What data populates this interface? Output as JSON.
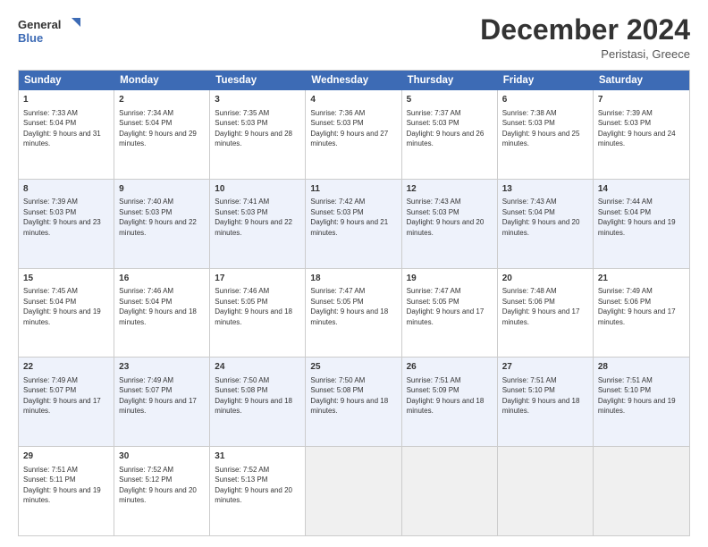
{
  "logo": {
    "line1": "General",
    "line2": "Blue"
  },
  "title": "December 2024",
  "location": "Peristasi, Greece",
  "days": [
    "Sunday",
    "Monday",
    "Tuesday",
    "Wednesday",
    "Thursday",
    "Friday",
    "Saturday"
  ],
  "weeks": [
    [
      {
        "date": "1",
        "sunrise": "7:33 AM",
        "sunset": "5:04 PM",
        "daylight": "9 hours and 31 minutes."
      },
      {
        "date": "2",
        "sunrise": "7:34 AM",
        "sunset": "5:04 PM",
        "daylight": "9 hours and 29 minutes."
      },
      {
        "date": "3",
        "sunrise": "7:35 AM",
        "sunset": "5:03 PM",
        "daylight": "9 hours and 28 minutes."
      },
      {
        "date": "4",
        "sunrise": "7:36 AM",
        "sunset": "5:03 PM",
        "daylight": "9 hours and 27 minutes."
      },
      {
        "date": "5",
        "sunrise": "7:37 AM",
        "sunset": "5:03 PM",
        "daylight": "9 hours and 26 minutes."
      },
      {
        "date": "6",
        "sunrise": "7:38 AM",
        "sunset": "5:03 PM",
        "daylight": "9 hours and 25 minutes."
      },
      {
        "date": "7",
        "sunrise": "7:39 AM",
        "sunset": "5:03 PM",
        "daylight": "9 hours and 24 minutes."
      }
    ],
    [
      {
        "date": "8",
        "sunrise": "7:39 AM",
        "sunset": "5:03 PM",
        "daylight": "9 hours and 23 minutes."
      },
      {
        "date": "9",
        "sunrise": "7:40 AM",
        "sunset": "5:03 PM",
        "daylight": "9 hours and 22 minutes."
      },
      {
        "date": "10",
        "sunrise": "7:41 AM",
        "sunset": "5:03 PM",
        "daylight": "9 hours and 22 minutes."
      },
      {
        "date": "11",
        "sunrise": "7:42 AM",
        "sunset": "5:03 PM",
        "daylight": "9 hours and 21 minutes."
      },
      {
        "date": "12",
        "sunrise": "7:43 AM",
        "sunset": "5:03 PM",
        "daylight": "9 hours and 20 minutes."
      },
      {
        "date": "13",
        "sunrise": "7:43 AM",
        "sunset": "5:04 PM",
        "daylight": "9 hours and 20 minutes."
      },
      {
        "date": "14",
        "sunrise": "7:44 AM",
        "sunset": "5:04 PM",
        "daylight": "9 hours and 19 minutes."
      }
    ],
    [
      {
        "date": "15",
        "sunrise": "7:45 AM",
        "sunset": "5:04 PM",
        "daylight": "9 hours and 19 minutes."
      },
      {
        "date": "16",
        "sunrise": "7:46 AM",
        "sunset": "5:04 PM",
        "daylight": "9 hours and 18 minutes."
      },
      {
        "date": "17",
        "sunrise": "7:46 AM",
        "sunset": "5:05 PM",
        "daylight": "9 hours and 18 minutes."
      },
      {
        "date": "18",
        "sunrise": "7:47 AM",
        "sunset": "5:05 PM",
        "daylight": "9 hours and 18 minutes."
      },
      {
        "date": "19",
        "sunrise": "7:47 AM",
        "sunset": "5:05 PM",
        "daylight": "9 hours and 17 minutes."
      },
      {
        "date": "20",
        "sunrise": "7:48 AM",
        "sunset": "5:06 PM",
        "daylight": "9 hours and 17 minutes."
      },
      {
        "date": "21",
        "sunrise": "7:49 AM",
        "sunset": "5:06 PM",
        "daylight": "9 hours and 17 minutes."
      }
    ],
    [
      {
        "date": "22",
        "sunrise": "7:49 AM",
        "sunset": "5:07 PM",
        "daylight": "9 hours and 17 minutes."
      },
      {
        "date": "23",
        "sunrise": "7:49 AM",
        "sunset": "5:07 PM",
        "daylight": "9 hours and 17 minutes."
      },
      {
        "date": "24",
        "sunrise": "7:50 AM",
        "sunset": "5:08 PM",
        "daylight": "9 hours and 18 minutes."
      },
      {
        "date": "25",
        "sunrise": "7:50 AM",
        "sunset": "5:08 PM",
        "daylight": "9 hours and 18 minutes."
      },
      {
        "date": "26",
        "sunrise": "7:51 AM",
        "sunset": "5:09 PM",
        "daylight": "9 hours and 18 minutes."
      },
      {
        "date": "27",
        "sunrise": "7:51 AM",
        "sunset": "5:10 PM",
        "daylight": "9 hours and 18 minutes."
      },
      {
        "date": "28",
        "sunrise": "7:51 AM",
        "sunset": "5:10 PM",
        "daylight": "9 hours and 19 minutes."
      }
    ],
    [
      {
        "date": "29",
        "sunrise": "7:51 AM",
        "sunset": "5:11 PM",
        "daylight": "9 hours and 19 minutes."
      },
      {
        "date": "30",
        "sunrise": "7:52 AM",
        "sunset": "5:12 PM",
        "daylight": "9 hours and 20 minutes."
      },
      {
        "date": "31",
        "sunrise": "7:52 AM",
        "sunset": "5:13 PM",
        "daylight": "9 hours and 20 minutes."
      },
      null,
      null,
      null,
      null
    ]
  ],
  "labels": {
    "sunrise": "Sunrise:",
    "sunset": "Sunset:",
    "daylight": "Daylight:"
  }
}
